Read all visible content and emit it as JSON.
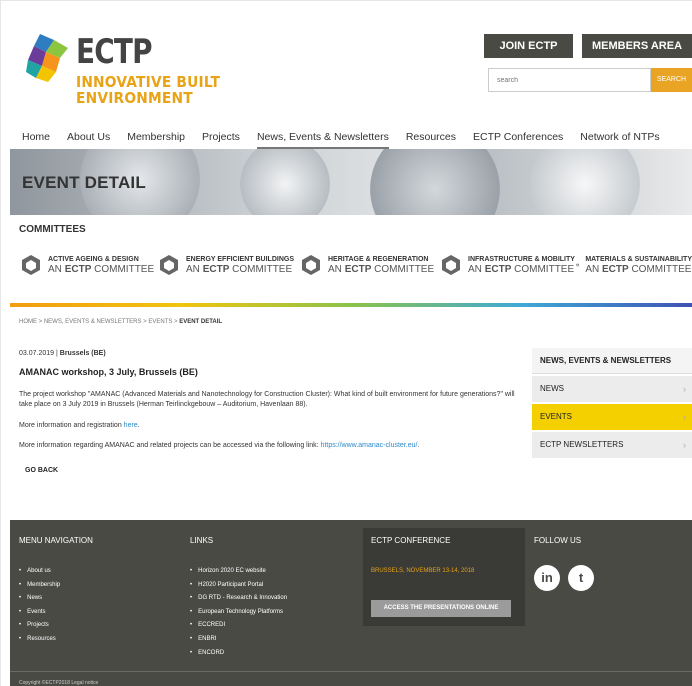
{
  "logo": {
    "name": "ECTP",
    "tagline_1": "INNOVATIVE BUILT",
    "tagline_2": "ENVIRONMENT"
  },
  "header": {
    "join_label": "JOIN ECTP",
    "members_label": "MEMBERS AREA",
    "search_placeholder": "search",
    "search_button": "SEARCH"
  },
  "nav": [
    "Home",
    "About Us",
    "Membership",
    "Projects",
    "News, Events & Newsletters",
    "Resources",
    "ECTP Conferences",
    "Network of NTPs"
  ],
  "nav_active": "News, Events & Newsletters",
  "banner": {
    "title": "EVENT DETAIL"
  },
  "committees": {
    "title": "COMMITTEES",
    "items": [
      {
        "line1": "ACTIVE AGEING & DESIGN",
        "line2_pre": "AN",
        "line2_brand": "ECTP",
        "line2_post": "COMMITTEE"
      },
      {
        "line1": "ENERGY EFFICIENT BUILDINGS",
        "line2_pre": "AN",
        "line2_brand": "ECTP",
        "line2_post": "COMMITTEE"
      },
      {
        "line1": "HERITAGE & REGENERATION",
        "line2_pre": "AN",
        "line2_brand": "ECTP",
        "line2_post": "COMMITTEE"
      },
      {
        "line1": "INFRASTRUCTURE & MOBILITY",
        "line2_pre": "AN",
        "line2_brand": "ECTP",
        "line2_post": "COMMITTEE"
      },
      {
        "line1": "MATERIALS & SUSTAINABILITY",
        "line2_pre": "AN",
        "line2_brand": "ECTP",
        "line2_post": "COMMITTEE"
      }
    ]
  },
  "breadcrumb": {
    "path": "HOME > NEWS, EVENTS & NEWSLETTERS > EVENTS > ",
    "current": "EVENT DETAIL"
  },
  "article": {
    "date": "03.07.2019",
    "location": "Brussels (BE)",
    "title": "AMANAC workshop, 3 July, Brussels (BE)",
    "para1": "The project workshop \"AMANAC (Advanced Materials and Nanotechnology for Construction Cluster): What kind of built environment for future generations?\" will take place on 3 July 2019 in Brussels (Herman Teirlinckgebouw – Auditorium, Havenlaan 88).",
    "para2_text": "More information and registration ",
    "para2_link": "here",
    "para2_end": ".",
    "para3_text": "More information regarding AMANAC and related projects can be accessed via the following link: ",
    "para3_link": "https://www.amanac-cluster.eu/",
    "para3_end": ".",
    "go_back": "GO BACK"
  },
  "sidebar": {
    "heading": "NEWS, EVENTS & NEWSLETTERS",
    "items": [
      {
        "label": "NEWS",
        "active": false
      },
      {
        "label": "EVENTS",
        "active": true
      },
      {
        "label": "ECTP NEWSLETTERS",
        "active": false
      }
    ]
  },
  "footer": {
    "menu_title": "MENU NAVIGATION",
    "menu_items": [
      "About us",
      "Membership",
      "News",
      "Events",
      "Projects",
      "Resources"
    ],
    "links_title": "LINKS",
    "links_items": [
      "Horizon 2020 EC website",
      "H2020 Participant Portal",
      "DG RTD - Research & Innovation",
      "European Technology Platforms",
      "ECCREDI",
      "ENBRI",
      "ENCORD"
    ],
    "conference_title": "ECTP CONFERENCE",
    "conference_date": "BRUSSELS, NOVEMBER 13-14, 2018",
    "conference_button": "ACCESS THE PRESENTATIONS ONLINE",
    "follow_title": "FOLLOW US",
    "social_1": "in",
    "social_2": "t",
    "copyright": "Copyright ©ECTP2018          Legal notice"
  },
  "colors": {
    "accent_orange": "#e9a424",
    "active_yellow": "#f5d000",
    "dark_gray": "#4a4a45"
  }
}
